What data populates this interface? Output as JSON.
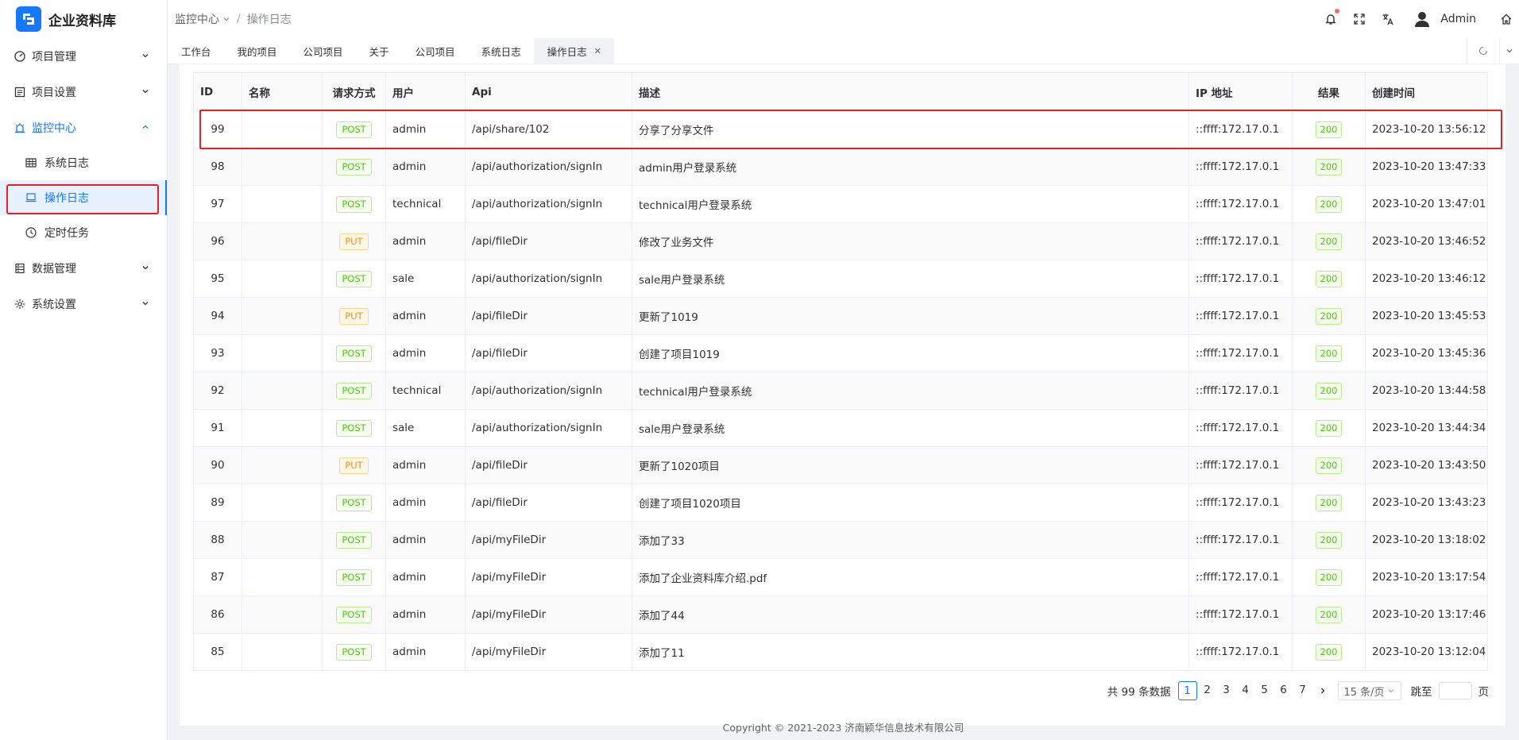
{
  "app": {
    "title": "企业资料库"
  },
  "breadcrumb": {
    "parent": "监控中心",
    "current": "操作日志"
  },
  "header": {
    "user": "Admin"
  },
  "sidebar": {
    "items": [
      {
        "label": "项目管理",
        "icon": "dashboard-icon"
      },
      {
        "label": "项目设置",
        "icon": "list-icon"
      },
      {
        "label": "监控中心",
        "icon": "alarm-icon",
        "open": true,
        "children": [
          {
            "label": "系统日志",
            "icon": "table-icon"
          },
          {
            "label": "操作日志",
            "icon": "monitor-icon",
            "active": true
          },
          {
            "label": "定时任务",
            "icon": "clock-icon"
          }
        ]
      },
      {
        "label": "数据管理",
        "icon": "database-icon"
      },
      {
        "label": "系统设置",
        "icon": "gear-icon"
      }
    ]
  },
  "tabs": [
    "工作台",
    "我的项目",
    "公司项目",
    "关于",
    "公司项目",
    "系统日志",
    "操作日志"
  ],
  "table": {
    "headers": [
      "ID",
      "名称",
      "请求方式",
      "用户",
      "Api",
      "描述",
      "IP 地址",
      "结果",
      "创建时间"
    ],
    "rows": [
      {
        "id": "99",
        "name": "",
        "method": "POST",
        "user": "admin",
        "api": "/api/share/102",
        "desc": "分享了分享文件",
        "ip": "::ffff:172.17.0.1",
        "result": "200",
        "time": "2023-10-20 13:56:12"
      },
      {
        "id": "98",
        "name": "",
        "method": "POST",
        "user": "admin",
        "api": "/api/authorization/signIn",
        "desc": "admin用户登录系统",
        "ip": "::ffff:172.17.0.1",
        "result": "200",
        "time": "2023-10-20 13:47:33"
      },
      {
        "id": "97",
        "name": "",
        "method": "POST",
        "user": "technical",
        "api": "/api/authorization/signIn",
        "desc": "technical用户登录系统",
        "ip": "::ffff:172.17.0.1",
        "result": "200",
        "time": "2023-10-20 13:47:01"
      },
      {
        "id": "96",
        "name": "",
        "method": "PUT",
        "user": "admin",
        "api": "/api/fileDir",
        "desc": "修改了业务文件",
        "ip": "::ffff:172.17.0.1",
        "result": "200",
        "time": "2023-10-20 13:46:52"
      },
      {
        "id": "95",
        "name": "",
        "method": "POST",
        "user": "sale",
        "api": "/api/authorization/signIn",
        "desc": "sale用户登录系统",
        "ip": "::ffff:172.17.0.1",
        "result": "200",
        "time": "2023-10-20 13:46:12"
      },
      {
        "id": "94",
        "name": "",
        "method": "PUT",
        "user": "admin",
        "api": "/api/fileDir",
        "desc": "更新了1019",
        "ip": "::ffff:172.17.0.1",
        "result": "200",
        "time": "2023-10-20 13:45:53"
      },
      {
        "id": "93",
        "name": "",
        "method": "POST",
        "user": "admin",
        "api": "/api/fileDir",
        "desc": "创建了项目1019",
        "ip": "::ffff:172.17.0.1",
        "result": "200",
        "time": "2023-10-20 13:45:36"
      },
      {
        "id": "92",
        "name": "",
        "method": "POST",
        "user": "technical",
        "api": "/api/authorization/signIn",
        "desc": "technical用户登录系统",
        "ip": "::ffff:172.17.0.1",
        "result": "200",
        "time": "2023-10-20 13:44:58"
      },
      {
        "id": "91",
        "name": "",
        "method": "POST",
        "user": "sale",
        "api": "/api/authorization/signIn",
        "desc": "sale用户登录系统",
        "ip": "::ffff:172.17.0.1",
        "result": "200",
        "time": "2023-10-20 13:44:34"
      },
      {
        "id": "90",
        "name": "",
        "method": "PUT",
        "user": "admin",
        "api": "/api/fileDir",
        "desc": "更新了1020项目",
        "ip": "::ffff:172.17.0.1",
        "result": "200",
        "time": "2023-10-20 13:43:50"
      },
      {
        "id": "89",
        "name": "",
        "method": "POST",
        "user": "admin",
        "api": "/api/fileDir",
        "desc": "创建了项目1020项目",
        "ip": "::ffff:172.17.0.1",
        "result": "200",
        "time": "2023-10-20 13:43:23"
      },
      {
        "id": "88",
        "name": "",
        "method": "POST",
        "user": "admin",
        "api": "/api/myFileDir",
        "desc": "添加了33",
        "ip": "::ffff:172.17.0.1",
        "result": "200",
        "time": "2023-10-20 13:18:02"
      },
      {
        "id": "87",
        "name": "",
        "method": "POST",
        "user": "admin",
        "api": "/api/myFileDir",
        "desc": "添加了企业资料库介绍.pdf",
        "ip": "::ffff:172.17.0.1",
        "result": "200",
        "time": "2023-10-20 13:17:54"
      },
      {
        "id": "86",
        "name": "",
        "method": "POST",
        "user": "admin",
        "api": "/api/myFileDir",
        "desc": "添加了44",
        "ip": "::ffff:172.17.0.1",
        "result": "200",
        "time": "2023-10-20 13:17:46"
      },
      {
        "id": "85",
        "name": "",
        "method": "POST",
        "user": "admin",
        "api": "/api/myFileDir",
        "desc": "添加了11",
        "ip": "::ffff:172.17.0.1",
        "result": "200",
        "time": "2023-10-20 13:12:04"
      }
    ]
  },
  "pagination": {
    "total_text": "共 99 条数据",
    "pages": [
      "1",
      "2",
      "3",
      "4",
      "5",
      "6",
      "7"
    ],
    "current": "1",
    "page_size": "15 条/页",
    "jump_label": "跳至",
    "page_label": "页",
    "jump_value": ""
  },
  "footer": {
    "copyright": "Copyright © 2021-2023 济南颖华信息技术有限公司"
  },
  "colors": {
    "accent": "#1677ff",
    "highlight": "#e02424",
    "post": "#52c41a",
    "put": "#fa8c16"
  }
}
